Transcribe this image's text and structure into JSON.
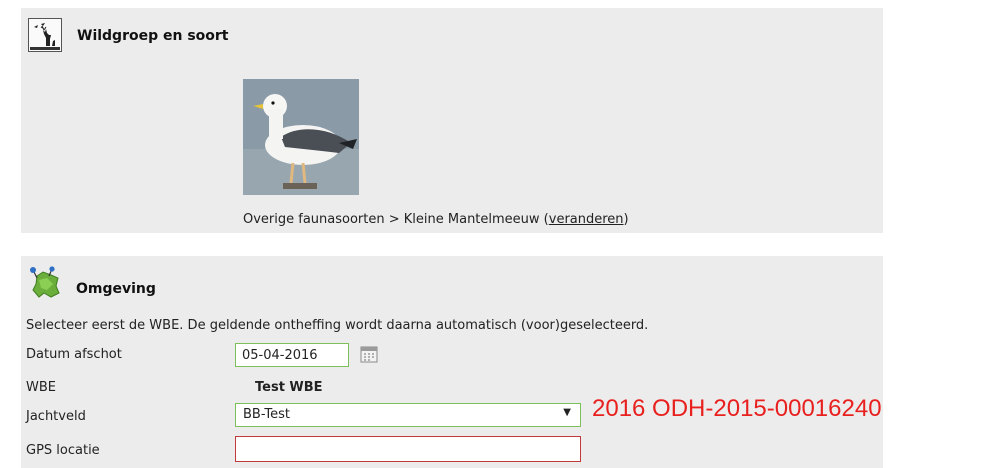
{
  "species_section": {
    "title": "Wildgroep en soort",
    "path_prefix": "Overige faunasoorten > Kleine Mantelmeeuw (",
    "change_link": "veranderen",
    "path_suffix": ")"
  },
  "environment_section": {
    "title": "Omgeving",
    "intro": "Selecteer eerst de WBE. De geldende ontheffing wordt daarna automatisch (voor)geselecteerd.",
    "date_label": "Datum afschot",
    "date_value": "05-04-2016",
    "wbe_label": "WBE",
    "wbe_value": "Test WBE",
    "jachtveld_label": "Jachtveld",
    "jachtveld_value": "BB-Test",
    "gps_label": "GPS locatie",
    "gps_value": ""
  },
  "annotation": {
    "text": "2016 ODH-2015-00016240",
    "color": "#e8201e"
  },
  "colors": {
    "panel_bg": "#ececec",
    "valid_border": "#7dbf5a",
    "invalid_border": "#c23a3a"
  }
}
